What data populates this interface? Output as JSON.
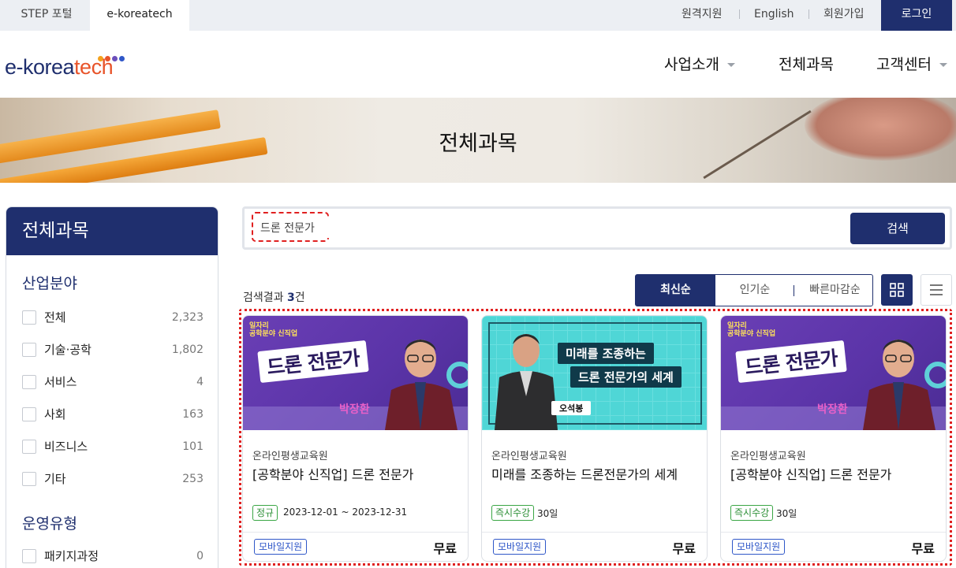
{
  "topbar": {
    "tabs": [
      "STEP 포털",
      "e-koreatech"
    ],
    "links": [
      "원격지원",
      "English",
      "회원가입"
    ],
    "login": "로그인"
  },
  "header": {
    "logo": {
      "text": "e-korea",
      "accent": "tech"
    },
    "nav": [
      "사업소개",
      "전체과목",
      "고객센터"
    ]
  },
  "hero": {
    "title": "전체과목"
  },
  "sidebar": {
    "title": "전체과목",
    "section1": "산업분야",
    "categories": [
      {
        "label": "전체",
        "count": "2,323"
      },
      {
        "label": "기술·공학",
        "count": "1,802"
      },
      {
        "label": "서비스",
        "count": "4"
      },
      {
        "label": "사회",
        "count": "163"
      },
      {
        "label": "비즈니스",
        "count": "101"
      },
      {
        "label": "기타",
        "count": "253"
      }
    ],
    "section2": "운영유형",
    "types": [
      {
        "label": "패키지과정",
        "count": "0"
      }
    ]
  },
  "search": {
    "value": "드론 전문가",
    "button": "검색"
  },
  "results": {
    "prefix": "검색결과",
    "count": "3",
    "suffix": "건",
    "sort": [
      "최신순",
      "인기순",
      "빠른마감순"
    ]
  },
  "cards": [
    {
      "thumb": {
        "brand1": "일자리",
        "brand2": "공학분야 신직업",
        "title": "드론 전문가",
        "name": "박장환"
      },
      "org": "온라인평생교육원",
      "title": "[공학분야 신직업] 드론 전문가",
      "tag": "정규",
      "period": "2023-12-01 ~ 2023-12-31",
      "mobile": "모바일지원",
      "price": "무료"
    },
    {
      "thumb": {
        "line1": "미래를 조종하는",
        "line2": "드론 전문가의 세계",
        "name": "오석봉"
      },
      "org": "온라인평생교육원",
      "title": "미래를 조종하는 드론전문가의 세계",
      "tag": "즉시수강",
      "period": "30일",
      "mobile": "모바일지원",
      "price": "무료"
    },
    {
      "thumb": {
        "brand1": "일자리",
        "brand2": "공학분야 신직업",
        "title": "드론 전문가",
        "name": "박장환"
      },
      "org": "온라인평생교육원",
      "title": "[공학분야 신직업] 드론 전문가",
      "tag": "즉시수강",
      "period": "30일",
      "mobile": "모바일지원",
      "price": "무료"
    }
  ],
  "colors": {
    "navy": "#1f2f6e",
    "accent_orange": "#e8542a",
    "highlight_red": "#e02020",
    "tag_green": "#2c8f36",
    "mobile_blue": "#2f57c8"
  }
}
